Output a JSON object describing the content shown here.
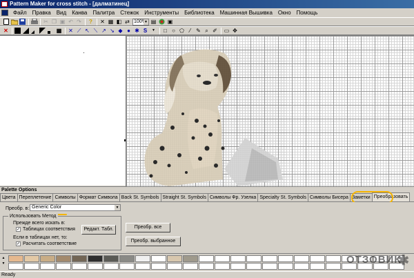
{
  "window": {
    "title": "Pattern Maker for cross stitch - [далматинец]"
  },
  "menu": [
    "Файл",
    "Правка",
    "Вид",
    "Канва",
    "Палитра",
    "Стежок",
    "Инструменты",
    "Библиотека",
    "Машинная Вышивка",
    "Окно",
    "Помощь"
  ],
  "toolbar1": {
    "icons": [
      "new-file-icon",
      "open-folder-icon",
      "save-icon",
      "print-icon",
      "cut-icon",
      "copy-icon",
      "paste-icon",
      "undo-icon",
      "redo-icon",
      "help-icon",
      "select-icon",
      "crop-icon",
      "fill-icon",
      "flip-icon"
    ],
    "zoom": "100%"
  },
  "toolbar2": {
    "icons": [
      "delete-icon",
      "full-stitch-icon",
      "half-stitch-icon",
      "quarter-stitch-icon",
      "three-quarter-stitch-icon",
      "petite-stitch-icon",
      "grid-icon",
      "cross-tool-icon",
      "backstitch-icon",
      "arrow-tool-icon",
      "diagonal-icon",
      "bead-icon",
      "french-knot-icon",
      "star-icon",
      "text-icon",
      "rectangle-icon",
      "lasso-icon",
      "magic-wand-icon",
      "zoom-tool-icon",
      "color-picker-icon"
    ]
  },
  "palette_options": {
    "title": "Palette Options",
    "tabs": [
      "Цвета",
      "Переплетение",
      "Символы",
      "Формат Символа",
      "Back St. Symbols",
      "Straight St. Symbols",
      "Символы Фр. Узелка",
      "Specialty St. Symbols",
      "Символы Бисера",
      "Заметки",
      "Преобразовать"
    ],
    "active_tab": "Преобразовать",
    "convert_to_label": "Преобр. в:",
    "convert_to_value": "Generic Color",
    "method_group_title": "Использовать Метод",
    "first_search_label": "Прежде всего искать в:",
    "match_table_label": "Таблицах соответствия",
    "edit_table_button": "Редакт. Табл.",
    "if_not_in_table_label": "Если в таблицах нет, то:",
    "calc_match_label": "Расчитать соответствие",
    "convert_all_button": "Преобр. все",
    "convert_selected_button": "Преобр. выбранное"
  },
  "swatch_colors": {
    "row1": [
      "#e6b98f",
      "#e3c9a6",
      "#c9ad86",
      "#a38a6d",
      "#726555",
      "#2d2d2d",
      "#5a5a55",
      "#8a8a86",
      "#f0f0f0",
      "#ffffff",
      "#d8c7ae",
      "#9f9a8c",
      "#ffffff",
      "#ffffff",
      "#ffffff",
      "#ffffff",
      "#ffffff",
      "#ffffff",
      "#ffffff",
      "#ffffff",
      "#ffffff",
      "#ffffff",
      "#ffffff",
      "#ffffff",
      "#ffffff"
    ],
    "row2": [
      "#ffffff",
      "#ffffff",
      "#ffffff",
      "#ffffff",
      "#ffffff",
      "#ffffff",
      "#ffffff",
      "#ffffff",
      "#ffffff",
      "#ffffff",
      "#ffffff",
      "#ffffff",
      "#ffffff",
      "#ffffff",
      "#ffffff",
      "#ffffff",
      "#ffffff",
      "#ffffff",
      "#ffffff",
      "#ffffff",
      "#ffffff",
      "#ffffff",
      "#ffffff",
      "#ffffff",
      "#ffffff"
    ]
  },
  "watermark": "ОТЗОВИК",
  "status": "Ready"
}
